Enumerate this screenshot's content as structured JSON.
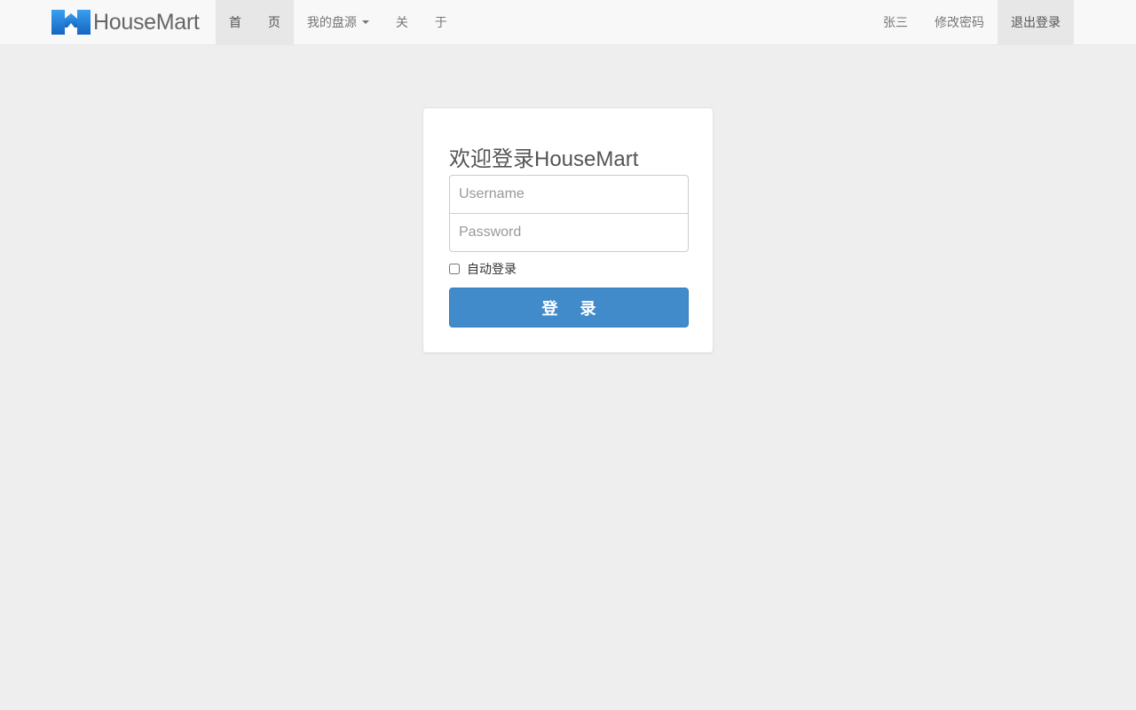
{
  "brand": {
    "name": "HouseMart",
    "logo_icon": "housemart-logo-icon"
  },
  "nav_left": {
    "home": "首 页",
    "listings": "我的盘源",
    "about": "关 于"
  },
  "nav_right": {
    "user": "张三",
    "change_password": "修改密码",
    "logout": "退出登录"
  },
  "login": {
    "title": "欢迎登录HouseMart",
    "username_placeholder": "Username",
    "username_value": "",
    "password_placeholder": "Password",
    "password_value": "",
    "remember_label": "自动登录",
    "remember_checked": false,
    "submit_label": "登 录"
  },
  "colors": {
    "page_bg": "#eeeeee",
    "navbar_bg": "#f8f8f8",
    "active_nav_bg": "#e7e7e7",
    "primary_button": "#428bca",
    "logo_blue": "#1e88e5"
  }
}
